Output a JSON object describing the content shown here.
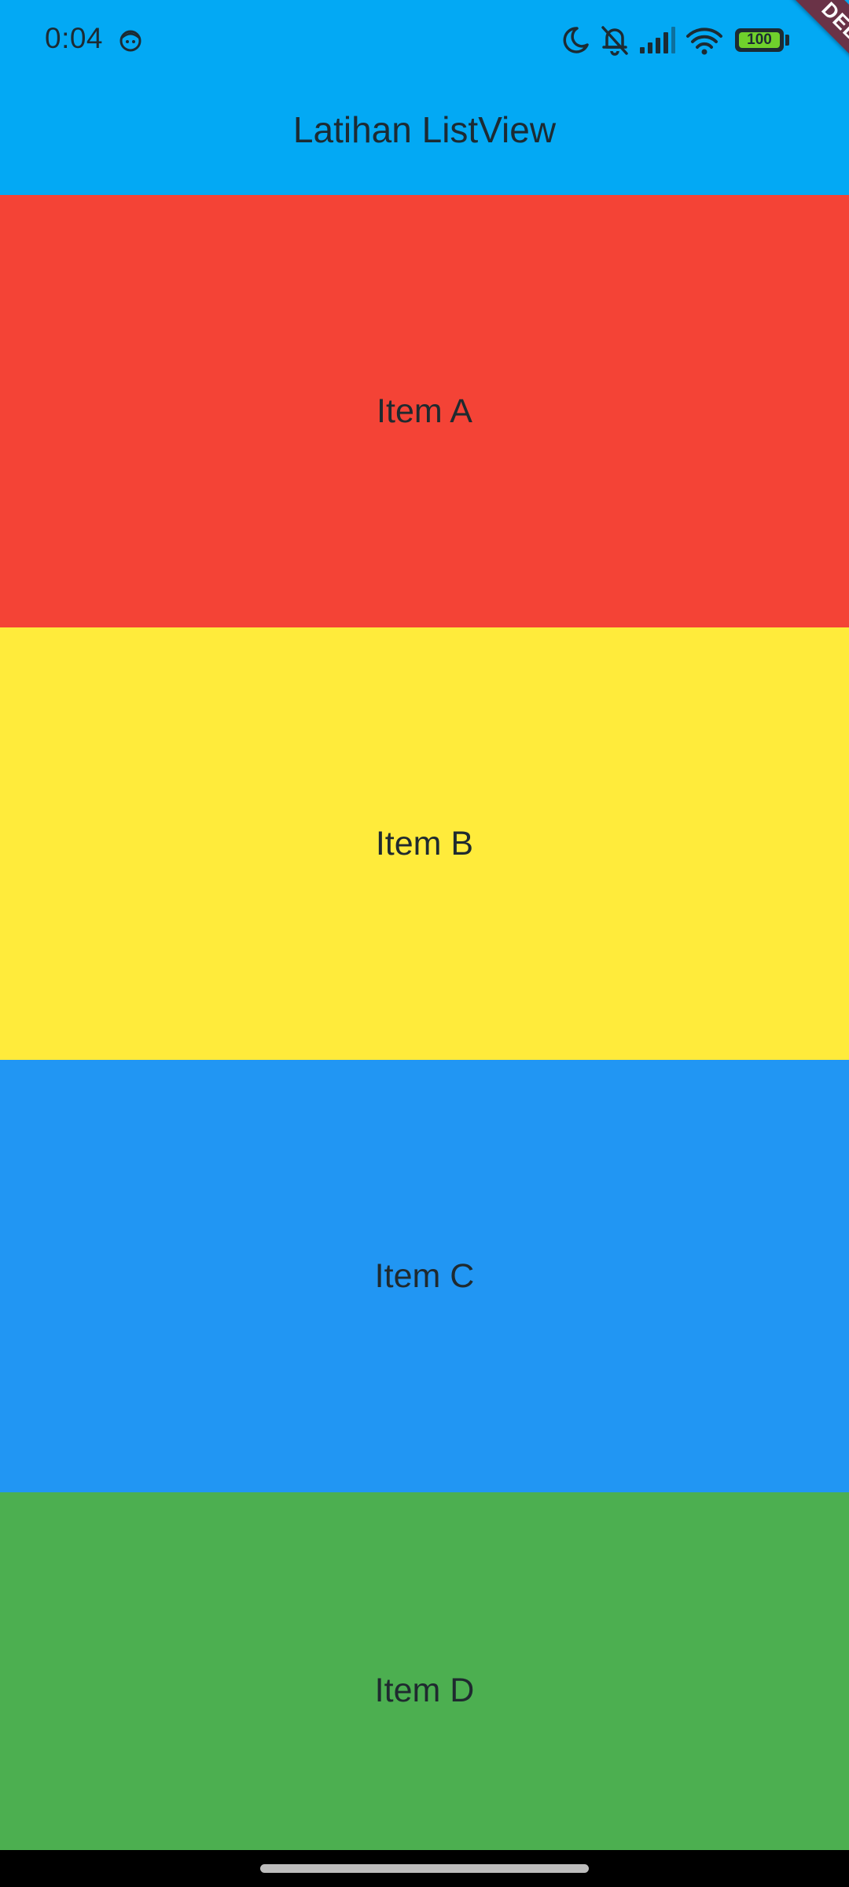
{
  "status_bar": {
    "time": "0:04",
    "battery_text": "100",
    "battery_level": 1.0,
    "icons": [
      "face-notification-icon",
      "moon-icon",
      "bell-muted-icon",
      "signal-icon",
      "wifi-icon",
      "battery-icon"
    ]
  },
  "app_bar": {
    "title": "Latihan ListView",
    "background": "#03A9F4"
  },
  "debug_banner": "DEBUG",
  "list": {
    "items": [
      {
        "label": "Item A",
        "color": "#F44336"
      },
      {
        "label": "Item B",
        "color": "#FFEB3B"
      },
      {
        "label": "Item C",
        "color": "#2196F3"
      },
      {
        "label": "Item D",
        "color": "#4CAF50"
      }
    ]
  },
  "nav_bar": {
    "background": "#000000"
  }
}
